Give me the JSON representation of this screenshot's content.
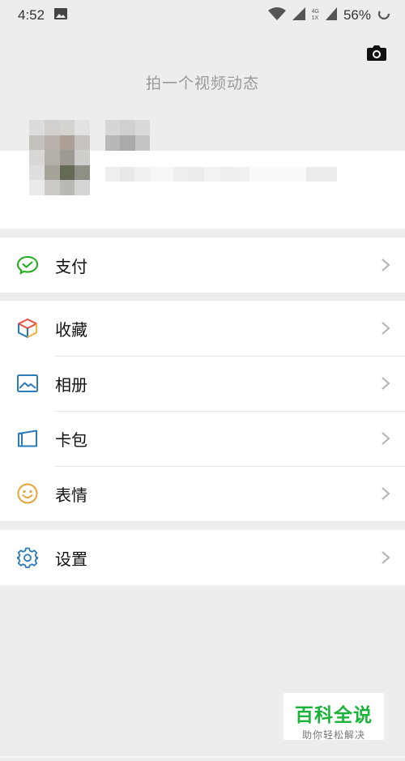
{
  "status_bar": {
    "time": "4:52",
    "network_label": "4G",
    "network_sub": "1X",
    "battery": "56%",
    "icons": [
      "image-notification-icon",
      "wifi-icon",
      "signal-icon",
      "signal-icon",
      "battery-ring-icon"
    ]
  },
  "header": {
    "moment_prompt": "拍一个视频动态",
    "camera_icon": "camera-icon"
  },
  "menu": {
    "pay": {
      "label": "支付",
      "icon": "wechat-pay-icon",
      "color": "#1aad19"
    },
    "favorites": {
      "label": "收藏",
      "icon": "cube-icon"
    },
    "album": {
      "label": "相册",
      "icon": "picture-icon",
      "color": "#2b7bb9"
    },
    "cards": {
      "label": "卡包",
      "icon": "card-icon",
      "color": "#2b7bb9"
    },
    "stickers": {
      "label": "表情",
      "icon": "smiley-icon",
      "color": "#e8a33a"
    },
    "settings": {
      "label": "设置",
      "icon": "gear-icon",
      "color": "#2b7bb9"
    }
  },
  "watermark": {
    "title": "百科全说",
    "subtitle": "助你轻松解决"
  }
}
